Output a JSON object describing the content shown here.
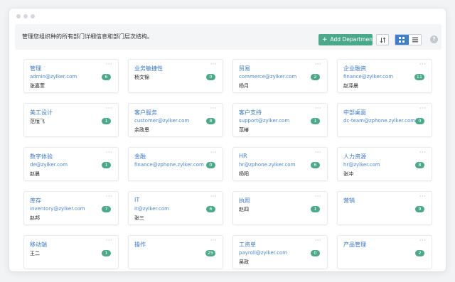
{
  "toolbar": {
    "description": "管理您组织种的所有部门详细信息和部门层次结构。",
    "add_label": "Add Department",
    "help_label": "?"
  },
  "colors": {
    "accent": "#4aa98b",
    "link": "#3b79c9",
    "toggle_active": "#3d7fd1"
  },
  "departments": [
    {
      "name": "管理",
      "email": "admin@zylker.com",
      "head": "张嘉萱",
      "count": "6"
    },
    {
      "name": "业务敏捷性",
      "email": "",
      "head": "杨文锦",
      "count": "0"
    },
    {
      "name": "贸易",
      "email": "commerce@zylker.com",
      "head": "杨月",
      "count": "2"
    },
    {
      "name": "企业融资",
      "email": "finance@zylker.com",
      "head": "赵泽晨",
      "count": "11"
    },
    {
      "name": "美工设计",
      "email": "",
      "head": "范恒飞",
      "count": "1"
    },
    {
      "name": "客户服务",
      "email": "customer@zylker.com",
      "head": "余政恩",
      "count": "8"
    },
    {
      "name": "客户支持",
      "email": "support@zylker.com",
      "head": "范椿",
      "count": "1"
    },
    {
      "name": "中部桌面",
      "email": "dc-team@zphone.zylker.com",
      "head": "",
      "count": "0"
    },
    {
      "name": "数字体验",
      "email": "de@zylker.com",
      "head": "赵晨",
      "count": "1"
    },
    {
      "name": "金融",
      "email": "finance@zphone.zylker.com",
      "head": "",
      "count": "0"
    },
    {
      "name": "HR",
      "email": "hr@zphone.zylker.com",
      "head": "杨阳",
      "count": "6"
    },
    {
      "name": "人力资源",
      "email": "hr@zylker.com",
      "head": "张冲",
      "count": "8"
    },
    {
      "name": "库存",
      "email": "inventory@zylker.com",
      "head": "赵邦",
      "count": "7"
    },
    {
      "name": "IT",
      "email": "it@zylker.com",
      "head": "张三",
      "count": "6"
    },
    {
      "name": "执照",
      "email": "",
      "head": "赵四",
      "count": "1"
    },
    {
      "name": "营销",
      "email": "",
      "head": "",
      "count": "9"
    },
    {
      "name": "移动端",
      "email": "",
      "head": "王二",
      "count": "1"
    },
    {
      "name": "操作",
      "email": "",
      "head": "",
      "count": "25"
    },
    {
      "name": "工资单",
      "email": "payroll@zylker.com",
      "head": "吴政",
      "count": "0"
    },
    {
      "name": "产品管理",
      "email": "",
      "head": "",
      "count": "2"
    }
  ]
}
